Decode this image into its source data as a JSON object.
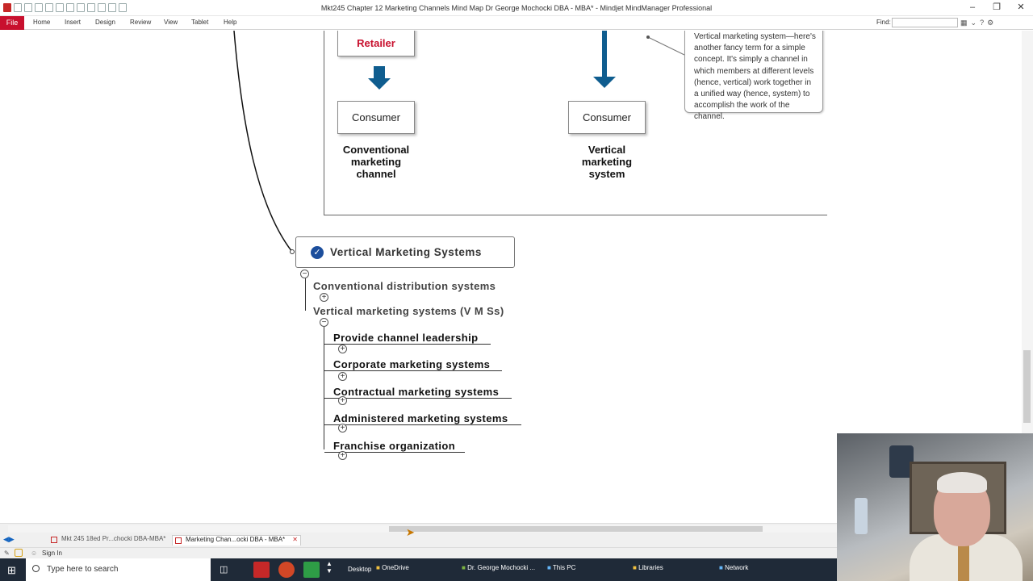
{
  "window": {
    "title": "Mkt245 Chapter 12 Marketing Channels Mind Map Dr George Mochocki DBA - MBA* - Mindjet MindManager Professional"
  },
  "ribbon": {
    "file": "File",
    "tabs": [
      "Home",
      "Insert",
      "Design",
      "Review",
      "View",
      "Tablet",
      "Help"
    ],
    "find_label": "Find:"
  },
  "diagram": {
    "retailer": "Retailer",
    "consumer_left": "Consumer",
    "consumer_right": "Consumer",
    "caption_left": [
      "Conventional",
      "marketing",
      "channel"
    ],
    "caption_right": [
      "Vertical",
      "marketing",
      "system"
    ],
    "callout_lines": [
      "Vertical marketing system—here's",
      "another fancy term for a simple",
      "concept. It's simply a channel in",
      "which members at different levels",
      "(hence, vertical) work together in",
      "a unified way (hence, system) to",
      "accomplish the work of the channel."
    ],
    "arrow_color": "#0f5d8f",
    "retailer_color": "#c8102e"
  },
  "mindmap": {
    "root": "Vertical Marketing Systems",
    "level1": [
      "Conventional distribution systems",
      "Vertical marketing systems (V M Ss)"
    ],
    "level2": [
      "Provide channel leadership",
      "Corporate marketing systems",
      "Contractual marketing systems",
      "Administered marketing systems",
      "Franchise organization"
    ]
  },
  "doc_tabs": [
    {
      "label": "Mkt 245 18ed Pr...chocki DBA-MBA*",
      "active": false
    },
    {
      "label": "Marketing Chan...ocki DBA - MBA*",
      "active": true
    }
  ],
  "status": {
    "sign_in": "Sign In"
  },
  "taskbar": {
    "search_placeholder": "Type here to search",
    "desktop": "Desktop",
    "items": [
      "OneDrive",
      "Dr. George Mochocki ...",
      "This PC",
      "Libraries",
      "Network"
    ]
  }
}
